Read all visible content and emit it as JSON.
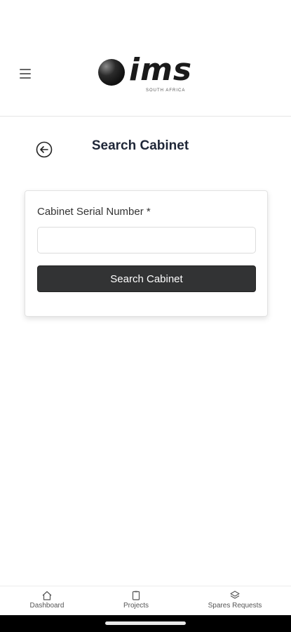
{
  "header": {
    "menu_icon": "hamburger-menu-icon",
    "logo_text": "ims",
    "logo_subtext": "SOUTH AFRICA"
  },
  "page": {
    "back_icon": "back-arrow-circle-icon",
    "title": "Search Cabinet"
  },
  "form": {
    "label": "Cabinet Serial Number *",
    "input_value": "",
    "input_placeholder": "",
    "button_label": "Search Cabinet"
  },
  "bottom_nav": {
    "items": [
      {
        "label": "Dashboard",
        "icon": "home-icon"
      },
      {
        "label": "Projects",
        "icon": "clipboard-icon"
      },
      {
        "label": "Spares Requests",
        "icon": "layers-icon"
      }
    ]
  },
  "colors": {
    "button_bg": "#323334",
    "title": "#1f2738",
    "nav_text": "#555555"
  }
}
